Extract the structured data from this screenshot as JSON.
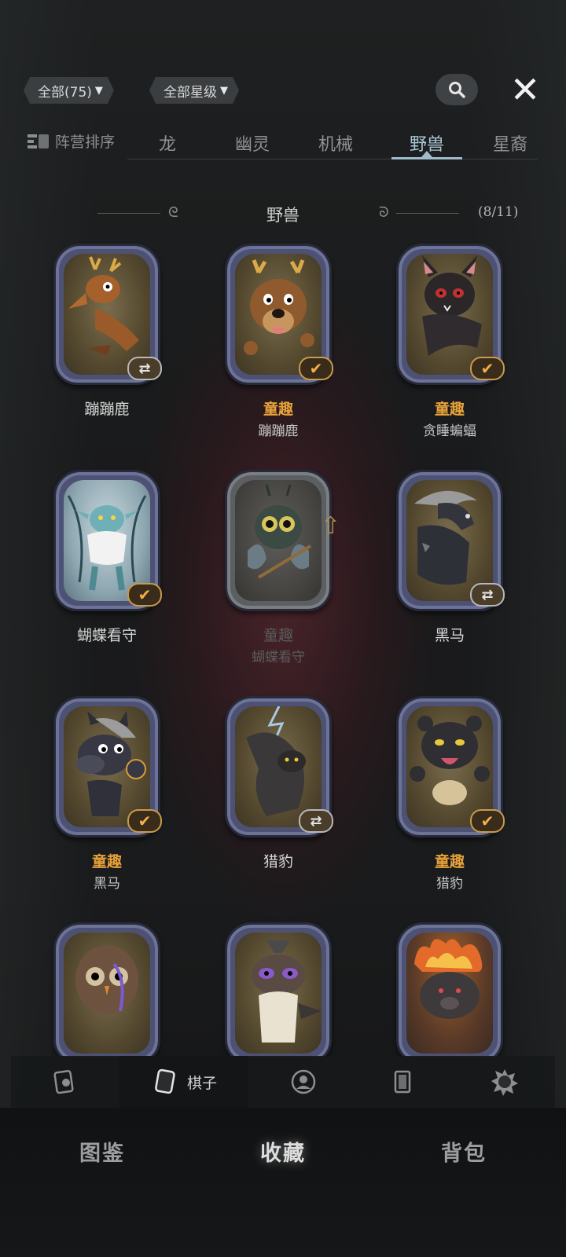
{
  "filters": {
    "all_label": "全部(75)",
    "star_label": "全部星级"
  },
  "icons": {
    "search": "search-icon",
    "close": "close-icon",
    "sort": "sort-icon"
  },
  "tabs": {
    "sort_label": "阵营排序",
    "items": [
      {
        "label": "龙"
      },
      {
        "label": "幽灵"
      },
      {
        "label": "机械"
      },
      {
        "label": "野兽",
        "active": true
      },
      {
        "label": "星裔"
      }
    ]
  },
  "section": {
    "title": "野兽",
    "count": "(8/11)"
  },
  "cards": [
    {
      "label1": "蹦蹦鹿",
      "label2": "",
      "badge": "swap"
    },
    {
      "label1": "童趣",
      "label2": "蹦蹦鹿",
      "badge": "check"
    },
    {
      "label1": "童趣",
      "label2": "贪睡蝙蝠",
      "badge": "check"
    },
    {
      "label1": "蝴蝶看守",
      "label2": "",
      "badge": "check"
    },
    {
      "label1": "童趣",
      "label2": "蝴蝶看守",
      "badge": "none"
    },
    {
      "label1": "黑马",
      "label2": "",
      "badge": "swap"
    },
    {
      "label1": "童趣",
      "label2": "黑马",
      "badge": "check"
    },
    {
      "label1": "猎豹",
      "label2": "",
      "badge": "swap"
    },
    {
      "label1": "童趣",
      "label2": "猎豹",
      "badge": "check"
    }
  ],
  "subnav": {
    "active_label": "棋子"
  },
  "bottom_nav": {
    "items": [
      {
        "label": "图鉴"
      },
      {
        "label": "收藏",
        "active": true
      },
      {
        "label": "背包"
      }
    ]
  },
  "colors": {
    "accent_gold": "#e8a23a",
    "tab_active": "#a8c7d4",
    "frame": "#4d5275"
  }
}
